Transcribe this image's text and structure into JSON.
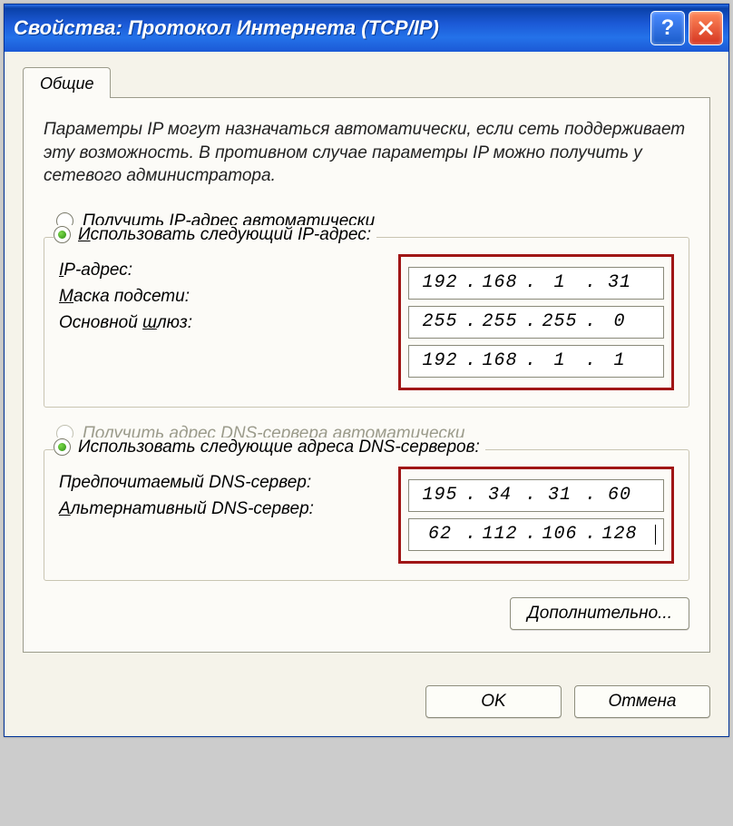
{
  "window": {
    "title": "Свойства: Протокол Интернета (TCP/IP)"
  },
  "tab": {
    "general": "Общие"
  },
  "description": "Параметры IP могут назначаться автоматически, если сеть поддерживает эту возможность. В противном случае параметры IP можно получить у сетевого администратора.",
  "ip_section": {
    "radio_auto": "Получить IP-адрес автоматически",
    "radio_auto_u": "П",
    "radio_manual": "Использовать следующий IP-адрес:",
    "radio_manual_u": "И",
    "ip_label": "IP-адрес:",
    "ip_label_u": "I",
    "mask_label": "Маска подсети:",
    "mask_label_u": "М",
    "gw_label": "Основной шлюз:",
    "gw_label_u": "ш",
    "ip": [
      "192",
      "168",
      "1",
      "31"
    ],
    "mask": [
      "255",
      "255",
      "255",
      "0"
    ],
    "gateway": [
      "192",
      "168",
      "1",
      "1"
    ]
  },
  "dns_section": {
    "radio_auto": "Получить адрес DNS-сервера автоматически",
    "radio_manual": "Использовать следующие адреса DNS-серверов:",
    "pref_label": "Предпочитаемый DNS-сервер:",
    "alt_label": "Альтернативный DNS-сервер:",
    "alt_label_u": "А",
    "preferred": [
      "195",
      "34",
      "31",
      "60"
    ],
    "alternate": [
      "62",
      "112",
      "106",
      "128"
    ]
  },
  "buttons": {
    "advanced": "Дополнительно...",
    "advanced_u": "Д",
    "ok": "OK",
    "cancel": "Отмена"
  }
}
